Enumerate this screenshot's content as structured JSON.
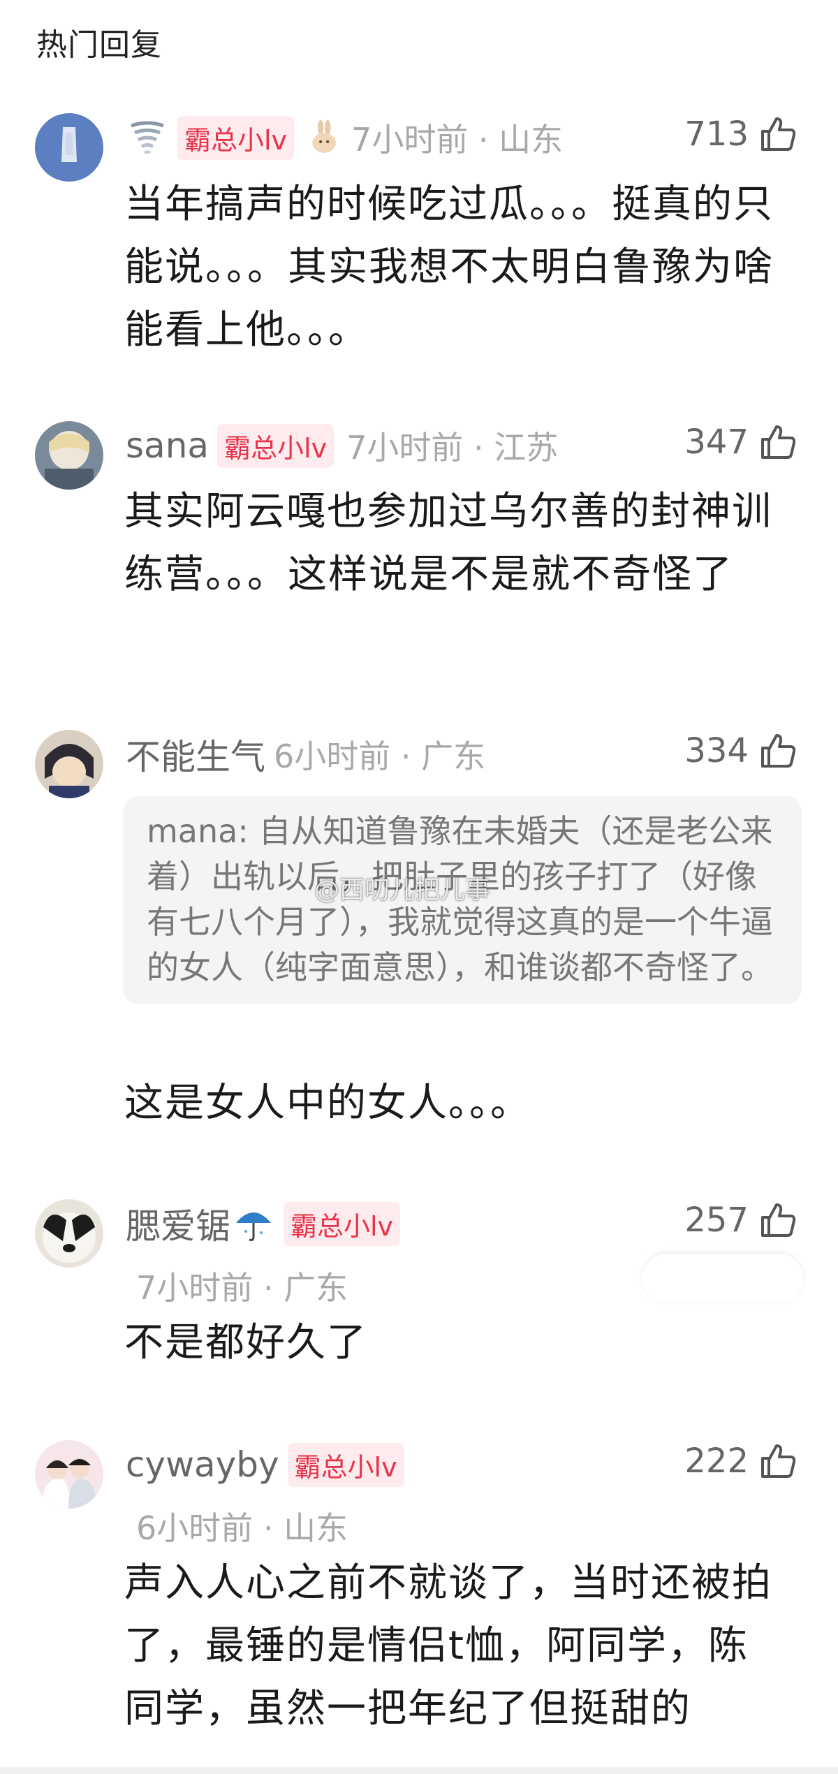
{
  "header": {
    "title": "热门回复"
  },
  "watermark": "@西叨儿把儿事",
  "comments": [
    {
      "username": "",
      "badge": "霸总小lv",
      "time": "7小时前",
      "location": "山东",
      "timeloc": "7小时前 · 山东",
      "likes": "713",
      "text": "当年搞声的时候吃过瓜。。。挺真的只能说。。。其实我想不太明白鲁豫为啥能看上他。。。",
      "icons": [
        "tornado-icon",
        "rabbit-icon"
      ]
    },
    {
      "username": "sana",
      "badge": "霸总小lv",
      "time": "7小时前",
      "location": "江苏",
      "timeloc": "7小时前 · 江苏",
      "likes": "347",
      "text": "其实阿云嘎也参加过乌尔善的封神训练营。。。这样说是不是就不奇怪了"
    },
    {
      "username": "不能生气",
      "time": "6小时前",
      "location": "广东",
      "timeloc": "6小时前 · 广东",
      "likes": "334",
      "quote": "mana: 自从知道鲁豫在未婚夫（还是老公来着）出轨以后，把肚子里的孩子打了（好像有七八个月了），我就觉得这真的是一个牛逼的女人（纯字面意思），和谁谈都不奇怪了。",
      "text": "这是女人中的女人。。。"
    },
    {
      "username": "腮爱锯",
      "badge": "霸总小lv",
      "time": "7小时前",
      "location": "广东",
      "timeloc": "7小时前 · 广东",
      "likes": "257",
      "text": "不是都好久了",
      "icons": [
        "umbrella-icon"
      ]
    },
    {
      "username": "cywayby",
      "badge": "霸总小lv",
      "time": "6小时前",
      "location": "山东",
      "timeloc": "6小时前 · 山东",
      "likes": "222",
      "text": "声入人心之前不就谈了，当时还被拍了，最锤的是情侣t恤，阿同学，陈同学，虽然一把年纪了但挺甜的"
    }
  ],
  "colors": {
    "badge_bg": "#fdebed",
    "badge_text": "#e8334a",
    "meta_gray": "#a8a8a8",
    "quote_bg": "#f4f4f5"
  }
}
